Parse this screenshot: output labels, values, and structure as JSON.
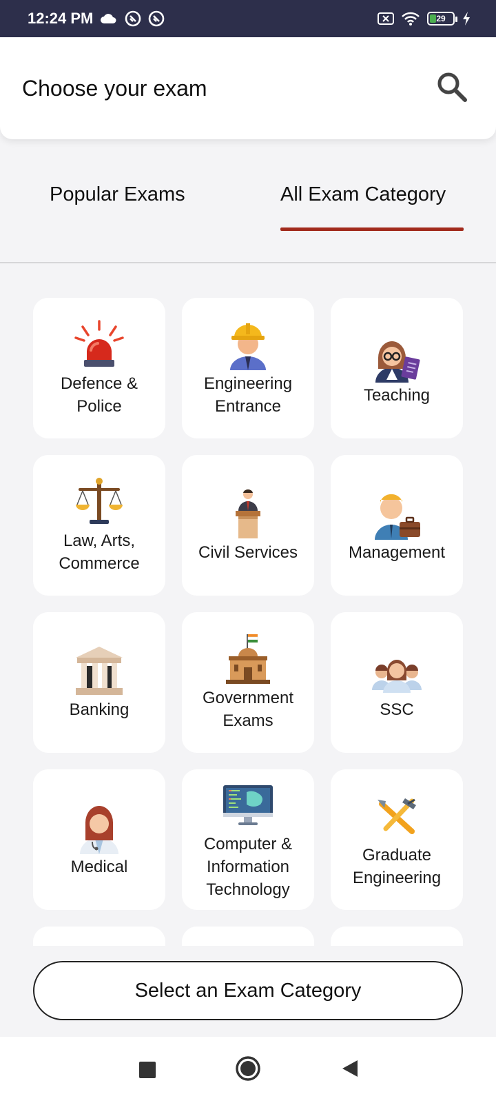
{
  "status_bar": {
    "time": "12:24 PM",
    "left_icons": [
      "cloud-icon",
      "notification-app-icon",
      "notification-app-icon"
    ],
    "right_icons": [
      "screen-record-icon",
      "wifi-icon",
      "battery-icon",
      "charging-icon"
    ],
    "battery_level": "29"
  },
  "header": {
    "title": "Choose your exam",
    "search_icon": "search-icon"
  },
  "tabs": [
    {
      "label": "Popular Exams",
      "active": false
    },
    {
      "label": "All Exam Category",
      "active": true
    }
  ],
  "colors": {
    "accent": "#a12a1c",
    "status_bar": "#2d2f4b",
    "background": "#f4f4f6",
    "card": "#ffffff"
  },
  "categories": [
    {
      "label": "Defence &\nPolice",
      "icon": "siren-icon"
    },
    {
      "label": "Engineering\nEntrance",
      "icon": "engineer-hardhat-icon"
    },
    {
      "label": "Teaching",
      "icon": "teacher-icon"
    },
    {
      "label": "Law, Arts,\nCommerce",
      "icon": "scales-icon"
    },
    {
      "label": "Civil Services",
      "icon": "podium-speaker-icon"
    },
    {
      "label": "Management",
      "icon": "manager-briefcase-icon"
    },
    {
      "label": "Banking",
      "icon": "bank-building-icon"
    },
    {
      "label": "Government\nExams",
      "icon": "government-building-icon"
    },
    {
      "label": "SSC",
      "icon": "people-group-icon"
    },
    {
      "label": "Medical",
      "icon": "doctor-icon"
    },
    {
      "label": "Computer &\nInformation\nTechnology",
      "icon": "computer-monitor-icon"
    },
    {
      "label": "Graduate\nEngineering",
      "icon": "tools-icon"
    }
  ],
  "select_button": {
    "label": "Select an Exam Category"
  },
  "nav_bar": {
    "buttons": [
      "recent-apps-icon",
      "home-icon",
      "back-icon"
    ]
  }
}
